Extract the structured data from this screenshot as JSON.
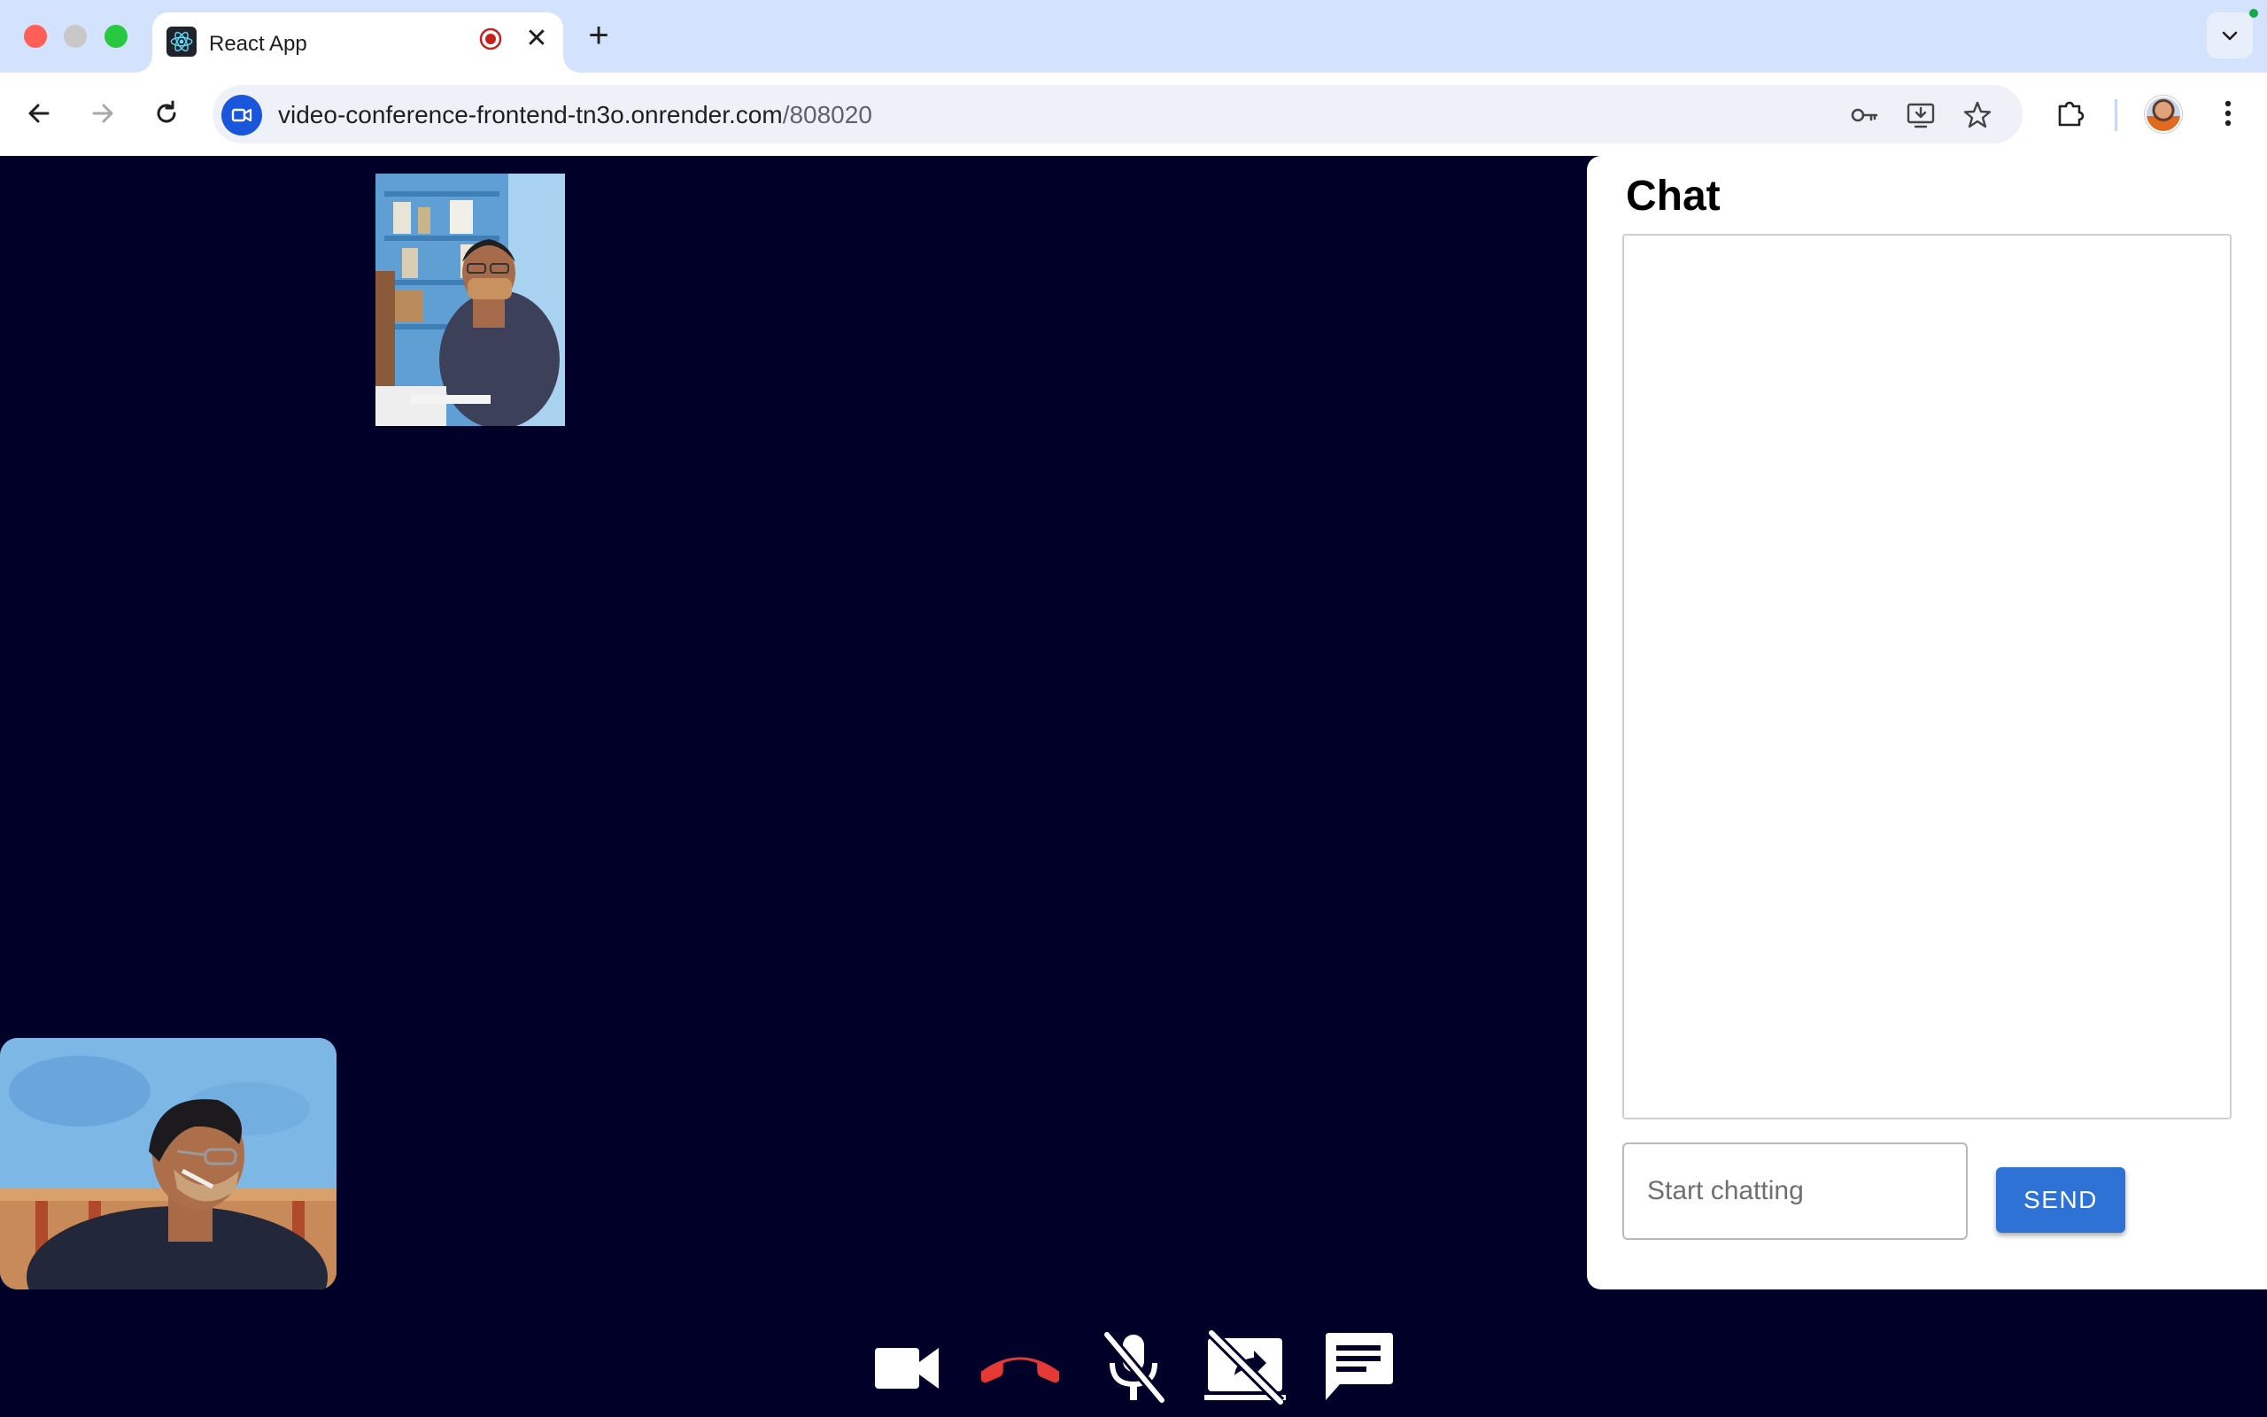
{
  "browser": {
    "tab_title": "React App",
    "url_host": "video-conference-frontend-tn3o.onrender.com",
    "url_path": "/808020"
  },
  "chat": {
    "title": "Chat",
    "input_placeholder": "Start chatting",
    "input_value": "",
    "send_label": "SEND"
  },
  "controls": {
    "items": [
      "camera",
      "end-call",
      "mic-off",
      "screen-share-off",
      "chat"
    ]
  },
  "colors": {
    "stage_background": "#000028",
    "end_call": "#e53935",
    "send_button": "#2f72d6",
    "tabstrip": "#d3e3fd"
  }
}
